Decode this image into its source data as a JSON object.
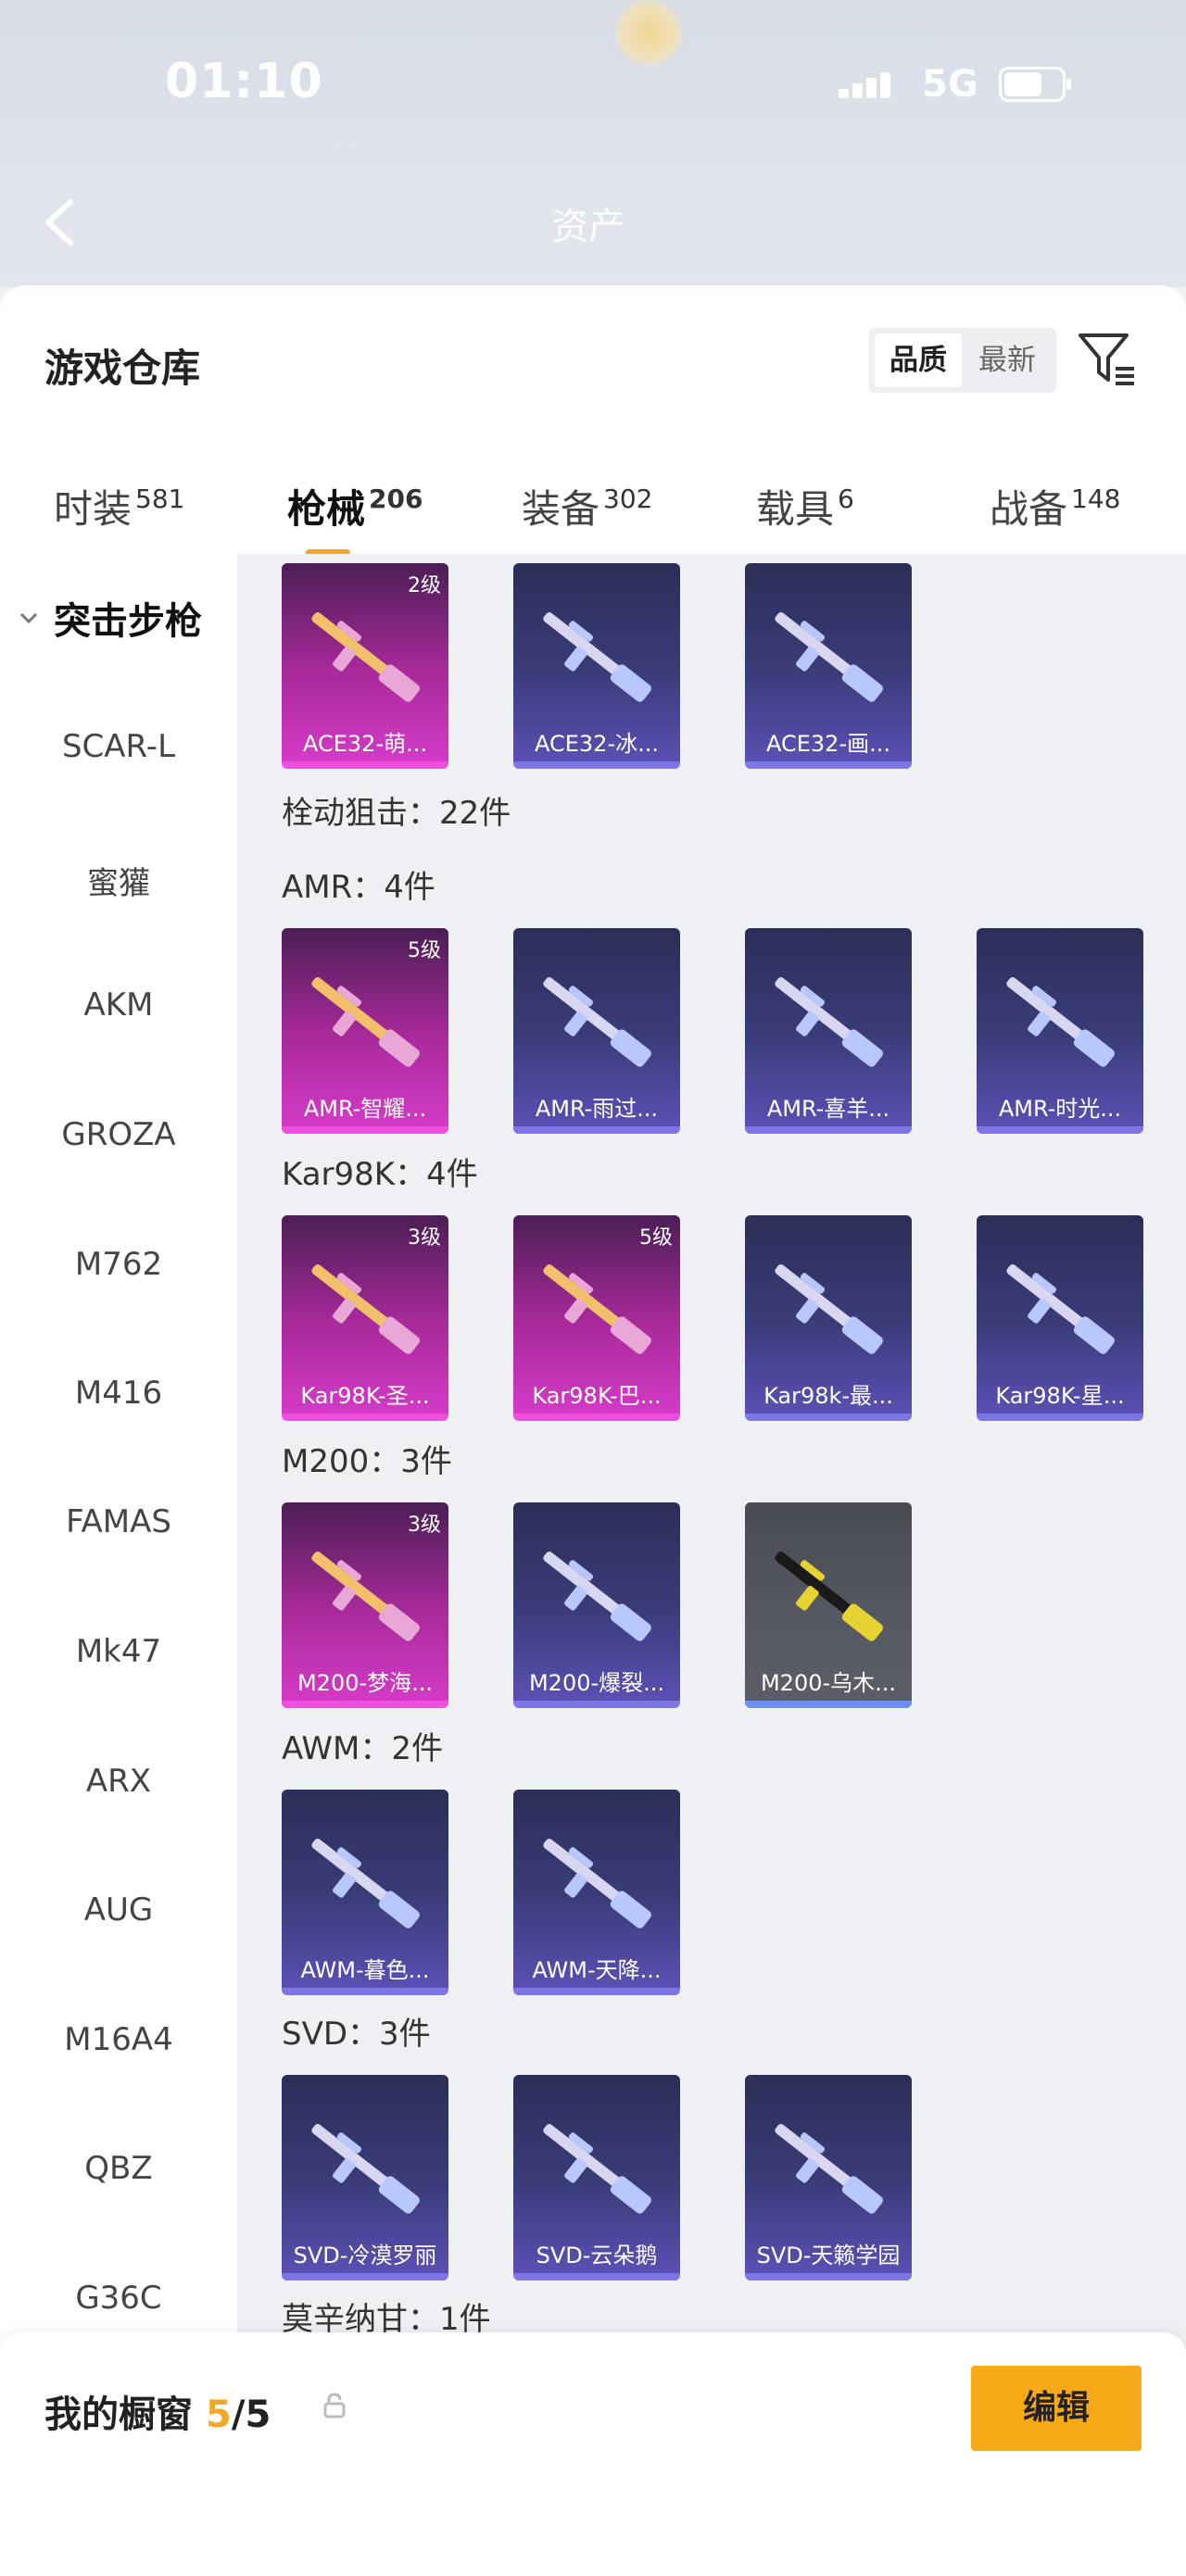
{
  "status_bar": {
    "time": "01:10",
    "network": "5G"
  },
  "header": {
    "title": "资产"
  },
  "page": {
    "title": "游戏仓库",
    "sort_options": [
      "品质",
      "最新"
    ],
    "active_sort": "品质"
  },
  "tabs": [
    {
      "label": "时装",
      "count": "581"
    },
    {
      "label": "枪械",
      "count": "206",
      "active": true
    },
    {
      "label": "装备",
      "count": "302"
    },
    {
      "label": "载具",
      "count": "6"
    },
    {
      "label": "战备",
      "count": "148"
    }
  ],
  "sidebar": {
    "category": "突击步枪",
    "items": [
      "SCAR-L",
      "蜜獾",
      "AKM",
      "GROZA",
      "M762",
      "M416",
      "FAMAS",
      "Mk47",
      "ARX",
      "AUG",
      "M16A4",
      "QBZ",
      "G36C"
    ]
  },
  "sections": [
    {
      "label": "",
      "items": [
        {
          "name": "ACE32-萌...",
          "level": "2级",
          "rarity": "pink"
        },
        {
          "name": "ACE32-冰...",
          "level": "",
          "rarity": "blue"
        },
        {
          "name": "ACE32-画...",
          "level": "",
          "rarity": "blue"
        }
      ]
    },
    {
      "label": "栓动狙击：22件",
      "items": []
    },
    {
      "label": "AMR：4件",
      "items": [
        {
          "name": "AMR-智耀...",
          "level": "5级",
          "rarity": "pink"
        },
        {
          "name": "AMR-雨过...",
          "level": "",
          "rarity": "blue"
        },
        {
          "name": "AMR-喜羊...",
          "level": "",
          "rarity": "blue"
        },
        {
          "name": "AMR-时光...",
          "level": "",
          "rarity": "blue"
        }
      ]
    },
    {
      "label": "Kar98K：4件",
      "items": [
        {
          "name": "Kar98K-圣...",
          "level": "3级",
          "rarity": "pink"
        },
        {
          "name": "Kar98K-巴...",
          "level": "5级",
          "rarity": "pink"
        },
        {
          "name": "Kar98k-最...",
          "level": "",
          "rarity": "blue"
        },
        {
          "name": "Kar98K-星...",
          "level": "",
          "rarity": "blue"
        }
      ]
    },
    {
      "label": "M200：3件",
      "items": [
        {
          "name": "M200-梦海...",
          "level": "3级",
          "rarity": "pink"
        },
        {
          "name": "M200-爆裂...",
          "level": "",
          "rarity": "blue"
        },
        {
          "name": "M200-乌木...",
          "level": "",
          "rarity": "grey"
        }
      ]
    },
    {
      "label": "AWM：2件",
      "items": [
        {
          "name": "AWM-暮色...",
          "level": "",
          "rarity": "blue"
        },
        {
          "name": "AWM-天降...",
          "level": "",
          "rarity": "blue"
        }
      ]
    },
    {
      "label": "SVD：3件",
      "items": [
        {
          "name": "SVD-冷漠罗丽",
          "level": "",
          "rarity": "blue"
        },
        {
          "name": "SVD-云朵鹅",
          "level": "",
          "rarity": "blue"
        },
        {
          "name": "SVD-天籁学园",
          "level": "",
          "rarity": "blue"
        }
      ]
    },
    {
      "label": "莫辛纳甘：1件",
      "items": []
    }
  ],
  "bottom": {
    "showcase_label": "我的橱窗",
    "showcase_count": "5",
    "showcase_total": "/5",
    "edit_label": "编辑"
  },
  "colors": {
    "accent": "#f5a623",
    "edit_button": "#f8a918"
  }
}
